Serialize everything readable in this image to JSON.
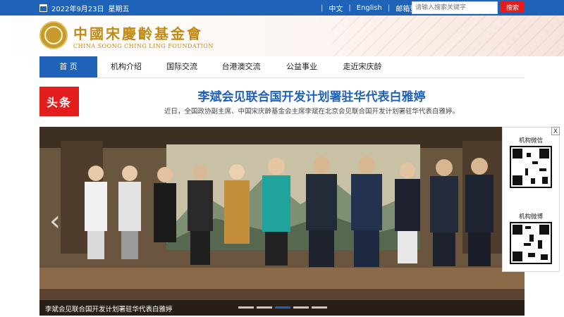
{
  "topbar": {
    "date": "2022年9月23日",
    "weekday": "星期五",
    "links": [
      "中文",
      "English",
      "邮箱登录"
    ],
    "search_placeholder": "请输入搜索关键字",
    "search_button": "搜索"
  },
  "header": {
    "logo_cn": "中國宋慶齡基金會",
    "logo_en": "CHINA SOONG CHING LING FOUNDATION"
  },
  "nav": {
    "items": [
      {
        "label": "首 页",
        "active": true
      },
      {
        "label": "机构介绍",
        "active": false
      },
      {
        "label": "国际交流",
        "active": false
      },
      {
        "label": "台港澳交流",
        "active": false
      },
      {
        "label": "公益事业",
        "active": false
      },
      {
        "label": "走近宋庆龄",
        "active": false
      }
    ]
  },
  "headline": {
    "badge": "头条",
    "title": "李斌会见联合国开发计划署驻华代表白雅婷",
    "summary": "近日，全国政协副主席、中国宋庆龄基金会主席李斌在北京会见联合国开发计划署驻华代表白雅婷。"
  },
  "slider": {
    "caption": "李斌会见联合国开发计划署驻华代表白雅婷",
    "slide_count": 5,
    "active_slide": 3,
    "prev_arrow": "‹",
    "next_arrow": "›"
  },
  "float_panel": {
    "close": "X",
    "wechat_label": "机构微信",
    "weibo_label": "机构微博"
  },
  "colors": {
    "primary": "#1f63b8",
    "accent_red": "#e31c1c",
    "gold": "#c08a16"
  }
}
